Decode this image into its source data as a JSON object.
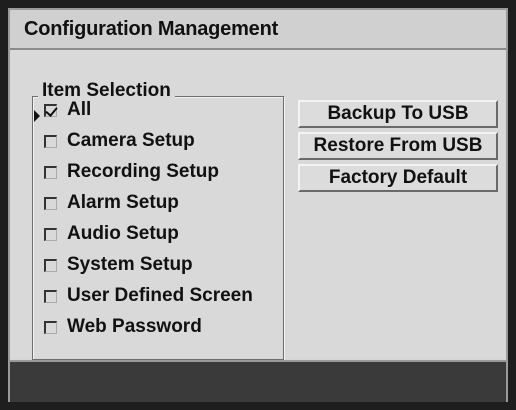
{
  "window": {
    "title": "Configuration Management"
  },
  "item_selection": {
    "legend": "Item Selection",
    "items": [
      {
        "label": "All",
        "checked": true,
        "selected": true
      },
      {
        "label": "Camera Setup",
        "checked": false
      },
      {
        "label": "Recording Setup",
        "checked": false
      },
      {
        "label": "Alarm Setup",
        "checked": false
      },
      {
        "label": "Audio Setup",
        "checked": false
      },
      {
        "label": "System Setup",
        "checked": false
      },
      {
        "label": "User Defined Screen",
        "checked": false
      },
      {
        "label": "Web Password",
        "checked": false
      }
    ]
  },
  "buttons": {
    "backup_label": "Backup To USB",
    "restore_label": "Restore From USB",
    "factory_label": "Factory Default"
  },
  "colors": {
    "panel": "#d9d9d9",
    "status_bar": "#3a3a3a",
    "text": "#111111"
  }
}
